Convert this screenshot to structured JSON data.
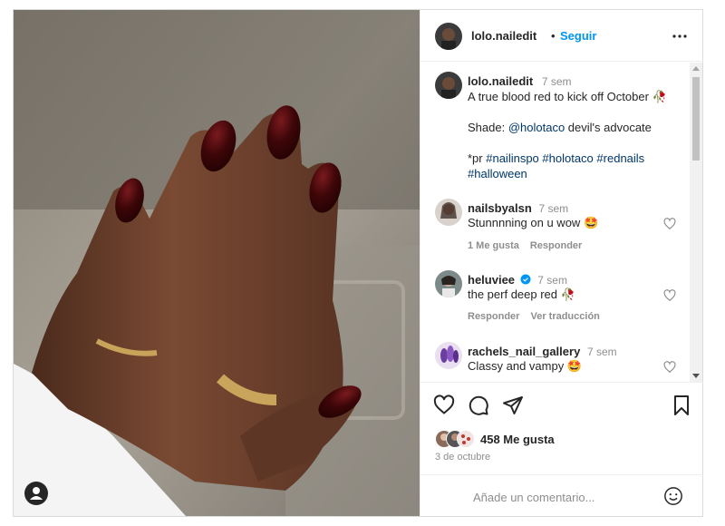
{
  "header": {
    "username": "lolo.nailedit",
    "separator": "•",
    "follow_label": "Seguir",
    "more_icon": "more-horizontal-icon"
  },
  "caption": {
    "username": "lolo.nailedit",
    "time": "7 sem",
    "line1": "A true blood red to kick off October",
    "line1_emoji": "🥀",
    "shade_prefix": "Shade: ",
    "shade_mention": "@holotaco",
    "shade_suffix": " devil's advocate",
    "pr_prefix": "*pr ",
    "tags": [
      "#nailinspo",
      "#holotaco",
      "#rednails",
      "#halloween"
    ]
  },
  "comments": [
    {
      "username": "nailsbyalsn",
      "time": "7 sem",
      "text": "Stunnnning on u wow",
      "emoji": "🤩",
      "likes": "1 Me gusta",
      "reply": "Responder",
      "translate": "",
      "verified": false
    },
    {
      "username": "heluviee",
      "time": "7 sem",
      "text": "the perf deep red",
      "emoji": "🥀",
      "likes": "",
      "reply": "Responder",
      "translate": "Ver traducción",
      "verified": true
    },
    {
      "username": "rachels_nail_gallery",
      "time": "7 sem",
      "text": "Classy and vampy",
      "emoji": "🤩",
      "likes": "",
      "reply": "",
      "translate": "",
      "verified": false
    }
  ],
  "actions": {
    "like_icon": "heart-icon",
    "comment_icon": "comment-bubble-icon",
    "share_icon": "paper-plane-icon",
    "save_icon": "bookmark-icon"
  },
  "likes_text": "458 Me gusta",
  "date": "3 de octubre",
  "comment_box": {
    "placeholder": "Añade un comentario...",
    "emoji_icon": "smiley-icon"
  },
  "colors": {
    "accent": "#0095f6",
    "link": "#00376b",
    "text": "#262626",
    "muted": "#8e8e8e",
    "nail": "#3d0608"
  }
}
